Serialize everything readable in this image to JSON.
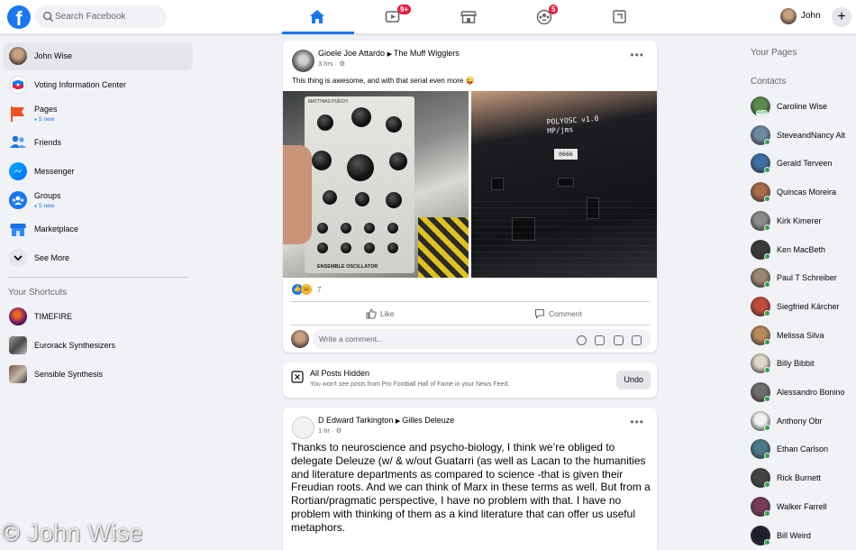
{
  "topbar": {
    "logo": "f",
    "search_placeholder": "Search Facebook",
    "tabs": [
      {
        "icon": "home-icon",
        "active": true
      },
      {
        "icon": "watch-icon",
        "badge": "9+"
      },
      {
        "icon": "marketplace-icon"
      },
      {
        "icon": "groups-icon",
        "badge": "5"
      },
      {
        "icon": "gaming-icon"
      }
    ],
    "profile_name": "John",
    "create_button": "+"
  },
  "left_nav": {
    "items": [
      {
        "label": "John Wise",
        "icon": "profile-avatar"
      },
      {
        "label": "Voting Information Center",
        "icon": "voting-icon"
      },
      {
        "label": "Pages",
        "sub": "5 new",
        "icon": "pages-flag-icon"
      },
      {
        "label": "Friends",
        "icon": "friends-icon"
      },
      {
        "label": "Messenger",
        "icon": "messenger-icon"
      },
      {
        "label": "Groups",
        "sub": "5 new",
        "icon": "groups-icon"
      },
      {
        "label": "Marketplace",
        "icon": "marketplace-icon"
      },
      {
        "label": "See More",
        "icon": "chevron-down-icon"
      }
    ],
    "shortcuts_title": "Your Shortcuts",
    "shortcuts": [
      {
        "label": "TIMEFIRE"
      },
      {
        "label": "Eurorack Synthesizers"
      },
      {
        "label": "Sensible Synthesis"
      }
    ]
  },
  "feed": {
    "post1": {
      "author": "Gioele Joe Attardo",
      "group": "The Muff Wigglers",
      "time": "3 hrs",
      "text": "This thing is awesome, and with that serial even more 😜",
      "module_brand": "MATTHIAS PUECH",
      "module_name": "ENSEMBLE OSCILLATOR",
      "pcb_label": "POLYOSC v1.0\nMP/jms",
      "serial": "0666",
      "reaction_count": "7",
      "like_label": "Like",
      "comment_label": "Comment",
      "comment_placeholder": "Write a comment..."
    },
    "hidden": {
      "title": "All Posts Hidden",
      "subtitle": "You won't see posts from Pro Football Hall of Fame in your News Feed.",
      "undo_label": "Undo"
    },
    "post2": {
      "author": "D Edward Tarkington",
      "group": "Gilles Deleuze",
      "time": "1 hr",
      "text": "Thanks to neuroscience and psycho-biology, I think we’re obliged to delegate Deleuze (w/ & w/out Guatarri (as well as Lacan to the humanities and literature departments as compared to science -that is given their Freudian roots. And we can think of Marx in these terms as well. But from a Rortian/pragmatic perspective, I have no problem with that. I have no problem with thinking of them as a kind literature that can offer us useful metaphors."
    }
  },
  "right": {
    "pages_title": "Your Pages",
    "contacts_title": "Contacts",
    "contacts": [
      {
        "name": "Caroline Wise",
        "status": "41m",
        "color": "#5b8a4a"
      },
      {
        "name": "SteveandNancy Alt",
        "color": "#6d8aa3"
      },
      {
        "name": "Gerald Terveen",
        "color": "#3d6fa6"
      },
      {
        "name": "Quincas Moreira",
        "color": "#a86b4c"
      },
      {
        "name": "Kirk Kimerer",
        "color": "#8b8b8b"
      },
      {
        "name": "Ken MacBeth",
        "color": "#3a3a3a"
      },
      {
        "name": "Paul T Schreiber",
        "color": "#9a8672"
      },
      {
        "name": "Siegfried Kärcher",
        "color": "#c24b3a"
      },
      {
        "name": "Melissa Silva",
        "color": "#b88a5a"
      },
      {
        "name": "Billy Bibbit",
        "color": "#e0d7c6"
      },
      {
        "name": "Alessandro Bonino",
        "color": "#6e6e6e"
      },
      {
        "name": "Anthony Obr",
        "color": "#f2f2f2"
      },
      {
        "name": "Ethan Carlson",
        "color": "#4a7a8c"
      },
      {
        "name": "Rick Burnett",
        "color": "#444444"
      },
      {
        "name": "Walker Farrell",
        "color": "#7a3b55"
      },
      {
        "name": "Bill Weird",
        "color": "#1e1e2e"
      }
    ]
  },
  "watermark": "© John Wise",
  "colors": {
    "accent": "#1877f2",
    "badge": "#e41e3f",
    "online": "#31a24c",
    "background": "#f0f2f5"
  }
}
